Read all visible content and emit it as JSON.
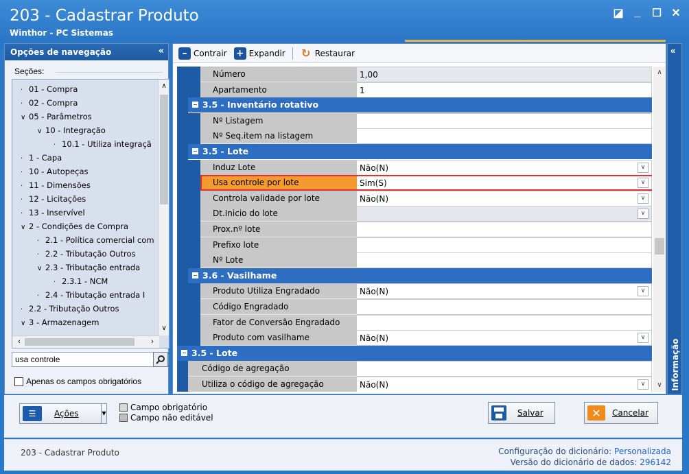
{
  "window": {
    "title": "203 - Cadastrar  Produto",
    "subtitle": "Winthor - PC Sistemas",
    "controls": [
      "◪",
      "_",
      "☐",
      "✕"
    ]
  },
  "nav": {
    "header": "Opções de navegação",
    "collapse": "«",
    "sections_label": "Seções:",
    "tree": [
      {
        "label": "01 - Compra",
        "level": 0,
        "exp": ""
      },
      {
        "label": "02 - Compra",
        "level": 0,
        "exp": ""
      },
      {
        "label": "05 - Parâmetros",
        "level": 0,
        "exp": "∨"
      },
      {
        "label": "10 - Integração",
        "level": 1,
        "exp": "∨"
      },
      {
        "label": "10.1 - Utiliza integraçã",
        "level": 2,
        "exp": ""
      },
      {
        "label": "1 - Capa",
        "level": 0,
        "exp": ""
      },
      {
        "label": "10 - Autopeças",
        "level": 0,
        "exp": ""
      },
      {
        "label": "11 - Dimensões",
        "level": 0,
        "exp": ""
      },
      {
        "label": "12 - Licitações",
        "level": 0,
        "exp": ""
      },
      {
        "label": "13 - Inservível",
        "level": 0,
        "exp": ""
      },
      {
        "label": "2 - Condições de Compra",
        "level": 0,
        "exp": "∨"
      },
      {
        "label": "2.1 - Política comercial com",
        "level": 1,
        "exp": ""
      },
      {
        "label": "2.2 - Tributação Outros",
        "level": 1,
        "exp": ""
      },
      {
        "label": "2.3 - Tributação entrada",
        "level": 1,
        "exp": "∨"
      },
      {
        "label": "2.3.1 - NCM",
        "level": 2,
        "exp": ""
      },
      {
        "label": "2.4 - Tributação entrada I",
        "level": 1,
        "exp": ""
      },
      {
        "label": "2.2 - Tributação Outros",
        "level": 0,
        "exp": ""
      },
      {
        "label": "3 - Armazenagem",
        "level": 0,
        "exp": "∨"
      }
    ],
    "search_value": "usa controle",
    "only_required_label": "Apenas os campos obrigatórios"
  },
  "toolbar": {
    "collapse_label": "Contrair",
    "expand_label": "Expandir",
    "restore_label": "Restaurar"
  },
  "grid": {
    "rows": [
      {
        "type": "field",
        "label": "Número",
        "value": "1,00",
        "indent": 2,
        "value_bg": "gray"
      },
      {
        "type": "field",
        "label": "Apartamento",
        "value": "1",
        "indent": 2
      },
      {
        "type": "section",
        "label": "3.5 - Inventário rotativo",
        "indent": 1
      },
      {
        "type": "field",
        "label": "Nº Listagem",
        "value": "",
        "indent": 2
      },
      {
        "type": "field",
        "label": "Nº Seq.item na listagem",
        "value": "",
        "indent": 2
      },
      {
        "type": "section",
        "label": "3.5 - Lote",
        "indent": 1
      },
      {
        "type": "field",
        "label": "Induz Lote",
        "value": "Não(N)",
        "indent": 2,
        "dropdown": true
      },
      {
        "type": "field",
        "label": "Usa controle por lote",
        "value": "Sim(S)",
        "indent": 2,
        "dropdown": true,
        "highlight": true
      },
      {
        "type": "field",
        "label": "Controla validade por lote",
        "value": "Não(N)",
        "indent": 2,
        "dropdown": true
      },
      {
        "type": "field",
        "label": "Dt.Inicio do lote",
        "value": "",
        "indent": 2,
        "dropdown": true,
        "value_bg": "gray"
      },
      {
        "type": "field",
        "label": "Prox.nº lote",
        "value": "",
        "indent": 2
      },
      {
        "type": "field",
        "label": "Prefixo lote",
        "value": "",
        "indent": 2
      },
      {
        "type": "field",
        "label": "Nº Lote",
        "value": "",
        "indent": 2
      },
      {
        "type": "section",
        "label": "3.6 - Vasilhame",
        "indent": 1
      },
      {
        "type": "field",
        "label": "Produto Utiliza Engradado",
        "value": "Não(N)",
        "indent": 2,
        "dropdown": true
      },
      {
        "type": "field",
        "label": "Código Engradado",
        "value": "",
        "indent": 2
      },
      {
        "type": "field",
        "label": "Fator de Conversão Engradado",
        "value": "",
        "indent": 2
      },
      {
        "type": "field",
        "label": "Produto com vasilhame",
        "value": "Não(N)",
        "indent": 2,
        "dropdown": true
      },
      {
        "type": "section",
        "label": "3.5 - Lote",
        "indent": 0
      },
      {
        "type": "field",
        "label": "Código de agregação",
        "value": "",
        "indent": 1
      },
      {
        "type": "field",
        "label": "Utiliza o código de agregação",
        "value": "Não(N)",
        "indent": 1,
        "dropdown": true
      }
    ]
  },
  "info_strip": {
    "label": "Informação",
    "collapse": "«"
  },
  "bottom": {
    "actions_label": "Ações",
    "legend_required": "Campo obrigatório",
    "legend_not_editable": "Campo não editável",
    "save_label": "Salvar",
    "cancel_label": "Cancelar"
  },
  "status": {
    "left": "203 - Cadastrar  Produto",
    "dict_config_label": "Configuração do dicionário:",
    "dict_config_value": "Personalizada",
    "dict_version_label": "Versão do dicionário de dados:",
    "dict_version_value": "296142"
  },
  "colors": {
    "title_blue": "#2a79c8",
    "section_blue": "#2e6ec2",
    "highlight_orange": "#f59a2e",
    "highlight_border": "#e03030",
    "cancel_orange": "#f08a1c"
  }
}
